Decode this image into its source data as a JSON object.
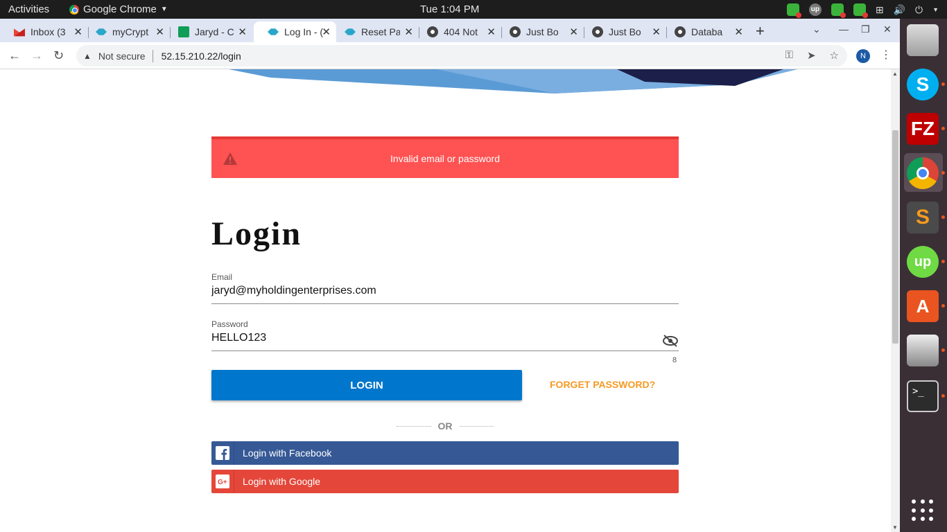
{
  "system": {
    "activities": "Activities",
    "app_name": "Google Chrome",
    "clock": "Tue  1:04 PM"
  },
  "tabs": [
    {
      "title": "Inbox (3",
      "favicon": "gmail-icon"
    },
    {
      "title": "myCrypt",
      "favicon": "cube-icon"
    },
    {
      "title": "Jaryd - C",
      "favicon": "sheets-icon"
    },
    {
      "title": "Log In - (",
      "favicon": "cube-icon"
    },
    {
      "title": "Reset Pa",
      "favicon": "cube-icon"
    },
    {
      "title": "404 Not",
      "favicon": "globe-icon"
    },
    {
      "title": "Just Bo",
      "favicon": "globe-icon"
    },
    {
      "title": "Just Bo",
      "favicon": "globe-icon"
    },
    {
      "title": "Databa",
      "favicon": "globe-icon"
    }
  ],
  "omnibox": {
    "security": "Not secure",
    "url": "52.15.210.22/login"
  },
  "profile": {
    "initial": "N"
  },
  "page": {
    "alert": "Invalid email or password",
    "heading": "Login",
    "email_label": "Email",
    "email_value": "jaryd@myholdingenterprises.com",
    "password_label": "Password",
    "password_value": "HELLO123",
    "password_counter": "8",
    "login_button": "LOGIN",
    "forget_link": "FORGET PASSWORD?",
    "or_text": "OR",
    "facebook_button": "Login with Facebook",
    "google_button": "Login with Google"
  },
  "colors": {
    "alert_bg": "#ff5252",
    "login_btn": "#0077cc",
    "forget_link": "#f59a23",
    "facebook": "#365996",
    "google": "#e4473a",
    "dock_bg": "#3b2f36"
  },
  "dock": [
    "files-icon",
    "skype-icon",
    "filezilla-icon",
    "chrome-icon",
    "sublime-icon",
    "upwork-icon",
    "software-center-icon",
    "printer-icon",
    "terminal-icon",
    "show-apps-icon"
  ]
}
